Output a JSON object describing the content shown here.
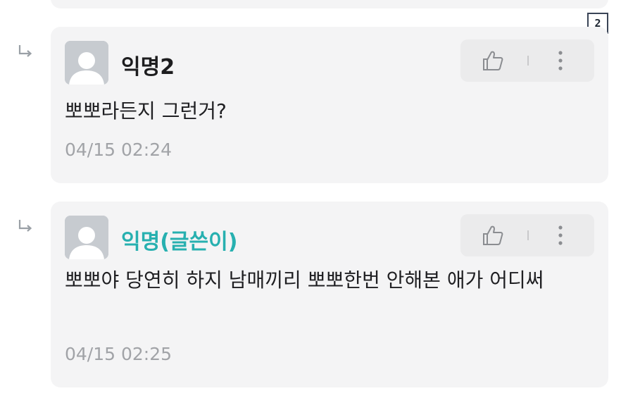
{
  "page_badge": "2",
  "comments": [
    {
      "author": "익명2",
      "text": "뽀뽀라든지 그런거?",
      "time": "04/15 02:24"
    },
    {
      "author": "익명(글쓴이)",
      "text": "뽀뽀야 당연히 하지 남매끼리 뽀뽀한번 안해본 애가 어디써",
      "time": "04/15 02:25",
      "author_color": "#27b0b0"
    }
  ],
  "colors": {
    "card_bg": "#f4f4f5",
    "op_accent": "#27b0b0",
    "timestamp": "#a1a3a7"
  },
  "icons": [
    "reply-arrow-icon",
    "avatar-placeholder-icon",
    "thumbs-up-icon",
    "more-vertical-icon"
  ]
}
